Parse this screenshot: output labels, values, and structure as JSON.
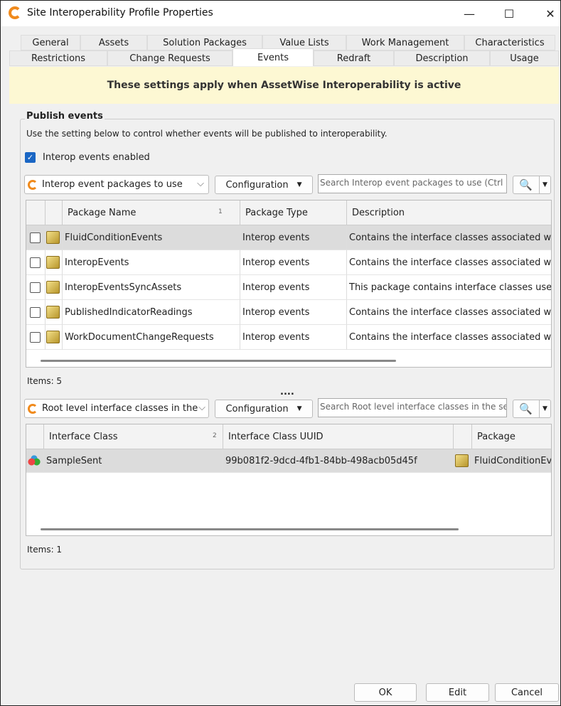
{
  "window": {
    "title": "Site Interoperability Profile Properties",
    "minimize": "—",
    "maximize": "☐",
    "close": "✕"
  },
  "tabs_row1": [
    "General",
    "Assets",
    "Solution Packages",
    "Value Lists",
    "Work Management",
    "Characteristics"
  ],
  "tabs_row2": [
    "Restrictions",
    "Change Requests",
    "Events",
    "Redraft",
    "Description",
    "Usage"
  ],
  "selected_tab": "Events",
  "banner": "These settings apply when AssetWise Interoperability is active",
  "publish": {
    "group_label": "Publish events",
    "hint": "Use the setting below to control whether events will be published to interoperability.",
    "checkbox_label": "Interop events enabled",
    "checkbox_checked": true
  },
  "toolbar1": {
    "combo": "Interop event packages to use",
    "config": "Configuration",
    "search_placeholder": "Search Interop event packages to use  (Ctrl"
  },
  "table1": {
    "headers": [
      "Package Name",
      "Package Type",
      "Description"
    ],
    "sort_marker": "1",
    "rows": [
      {
        "name": "FluidConditionEvents",
        "type": "Interop events",
        "desc": "Contains the interface classes associated with F"
      },
      {
        "name": "InteropEvents",
        "type": "Interop events",
        "desc": "Contains the interface classes associated with I"
      },
      {
        "name": "InteropEventsSyncAssets",
        "type": "Interop events",
        "desc": "This package contains interface classes used fo"
      },
      {
        "name": "PublishedIndicatorReadings",
        "type": "Interop events",
        "desc": "Contains the interface classes associated with p"
      },
      {
        "name": "WorkDocumentChangeRequests",
        "type": "Interop events",
        "desc": "Contains the interface classes associated with I"
      }
    ],
    "items": "Items: 5"
  },
  "splitter": "....",
  "toolbar2": {
    "combo": "Root level interface classes in the s",
    "config": "Configuration",
    "search_placeholder": "Search Root level interface classes in the se"
  },
  "table2": {
    "headers": [
      "Interface Class",
      "Interface Class UUID",
      "Package"
    ],
    "sort_marker": "2",
    "rows": [
      {
        "cls": "SampleSent",
        "uuid": "99b081f2-9dcd-4fb1-84bb-498acb05d45f",
        "pkg": "FluidConditionEver"
      }
    ],
    "items": "Items: 1"
  },
  "buttons": {
    "ok": "OK",
    "edit": "Edit",
    "cancel": "Cancel"
  }
}
